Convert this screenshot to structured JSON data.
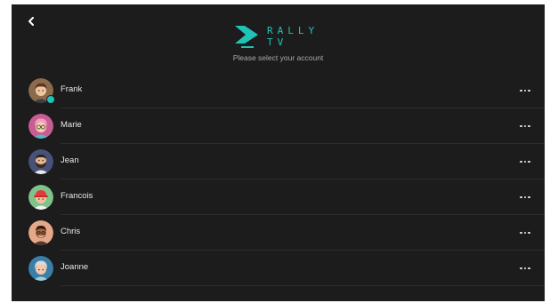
{
  "header": {
    "brand_line1": "RALLY",
    "brand_line2": "TV",
    "subtitle": "Please select your account"
  },
  "accounts": [
    {
      "name": "Frank",
      "avatar_icon": "man-brown-hair-avatar-icon",
      "avatar_bg": "#8c6a4c",
      "active": true
    },
    {
      "name": "Marie",
      "avatar_icon": "woman-pink-hair-glasses-avatar-icon",
      "avatar_bg": "#c95d93",
      "active": false
    },
    {
      "name": "Jean",
      "avatar_icon": "man-beard-avatar-icon",
      "avatar_bg": "#485279",
      "active": false
    },
    {
      "name": "Francois",
      "avatar_icon": "boy-red-cap-avatar-icon",
      "avatar_bg": "#7fc28c",
      "active": false
    },
    {
      "name": "Chris",
      "avatar_icon": "man-glasses-avatar-icon",
      "avatar_bg": "#e7a789",
      "active": false
    },
    {
      "name": "Joanne",
      "avatar_icon": "elderly-woman-avatar-icon",
      "avatar_bg": "#3a7fa8",
      "active": false
    }
  ],
  "colors": {
    "background": "#1c1c1c",
    "brand_teal": "#20c4b6",
    "text": "#e8e8e8",
    "subtitle": "#a9a9a9"
  }
}
